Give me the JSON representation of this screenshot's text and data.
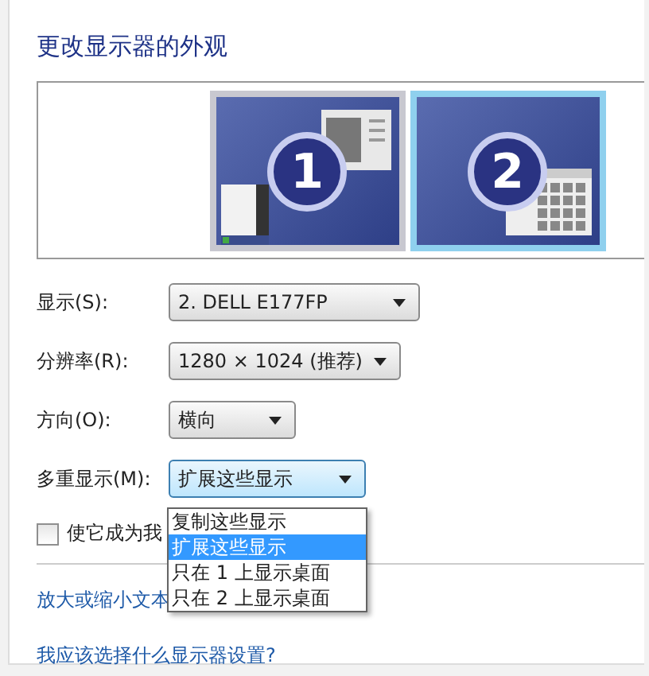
{
  "title": "更改显示器的外观",
  "monitors": [
    {
      "number": "1",
      "selected": false,
      "kind": "windows"
    },
    {
      "number": "2",
      "selected": true,
      "kind": "calendar"
    }
  ],
  "fields": [
    {
      "label": "显示(S):",
      "value": "2. DELL E177FP",
      "focused": false
    },
    {
      "label": "分辨率(R):",
      "value": "1280 × 1024 (推荐)",
      "focused": false
    },
    {
      "label": "方向(O):",
      "value": "横向",
      "focused": false
    },
    {
      "label": "多重显示(M):",
      "value": "扩展这些显示",
      "focused": true
    }
  ],
  "dropdown_options": [
    {
      "label": "复制这些显示",
      "selected": false
    },
    {
      "label": "扩展这些显示",
      "selected": true
    },
    {
      "label": "只在 1 上显示桌面",
      "selected": false
    },
    {
      "label": "只在 2 上显示桌面",
      "selected": false
    }
  ],
  "checkbox": {
    "label": "使它成为我",
    "checked": false
  },
  "links": [
    "放大或缩小文本",
    "我应该选择什么显示器设置?"
  ]
}
